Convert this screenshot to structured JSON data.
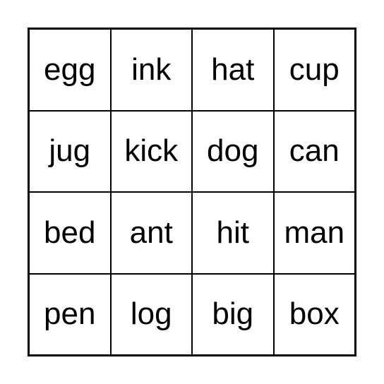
{
  "card": {
    "rows": [
      [
        "egg",
        "ink",
        "hat",
        "cup"
      ],
      [
        "jug",
        "kick",
        "dog",
        "can"
      ],
      [
        "bed",
        "ant",
        "hit",
        "man"
      ],
      [
        "pen",
        "log",
        "big",
        "box"
      ]
    ]
  }
}
